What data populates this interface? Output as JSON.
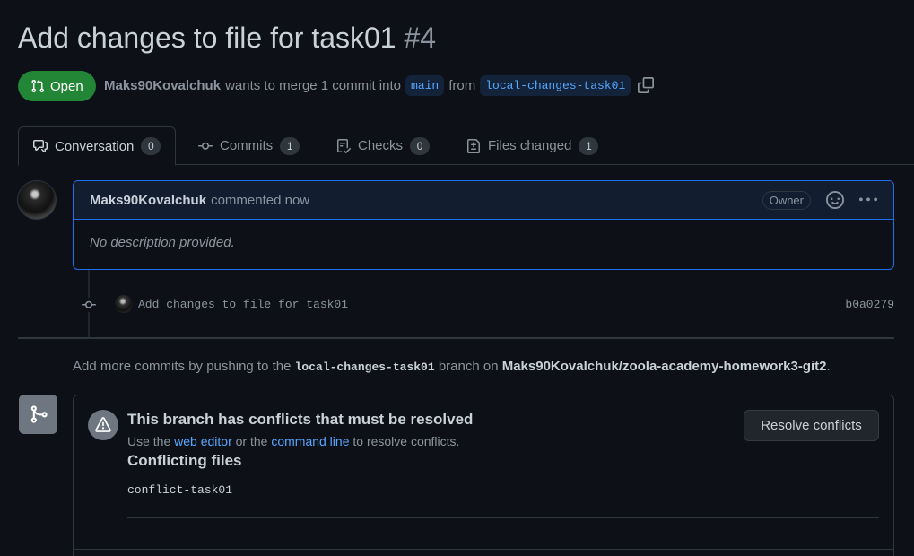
{
  "pr": {
    "title": "Add changes to file for task01",
    "number": "#4",
    "state": "Open",
    "author": "Maks90Kovalchuk",
    "merge_text": "wants to merge 1 commit into",
    "base_branch": "main",
    "from_text": "from",
    "head_branch": "local-changes-task01"
  },
  "tabs": [
    {
      "label": "Conversation",
      "count": "0",
      "icon": "comment-discussion-icon"
    },
    {
      "label": "Commits",
      "count": "1",
      "icon": "git-commit-icon"
    },
    {
      "label": "Checks",
      "count": "0",
      "icon": "checklist-icon"
    },
    {
      "label": "Files changed",
      "count": "1",
      "icon": "file-diff-icon"
    }
  ],
  "comment": {
    "author": "Maks90Kovalchuk",
    "when": "commented now",
    "badge": "Owner",
    "body": "No description provided."
  },
  "commit": {
    "message": "Add changes to file for task01",
    "sha": "b0a0279"
  },
  "push_hint": {
    "prefix": "Add more commits by pushing to the",
    "branch": "local-changes-task01",
    "middle": "branch on",
    "repo": "Maks90Kovalchuk/zoola-academy-homework3-git2",
    "suffix": "."
  },
  "merge": {
    "title": "This branch has conflicts that must be resolved",
    "desc_prefix": "Use the",
    "web_editor_link": "web editor",
    "desc_middle": "or the",
    "command_line_link": "command line",
    "desc_suffix": "to resolve conflicts.",
    "files_heading": "Conflicting files",
    "files": [
      "conflict-task01"
    ],
    "resolve_button": "Resolve conflicts"
  },
  "colors": {
    "open_green": "#238636",
    "link_blue": "#58a6ff",
    "background": "#0d1117"
  }
}
